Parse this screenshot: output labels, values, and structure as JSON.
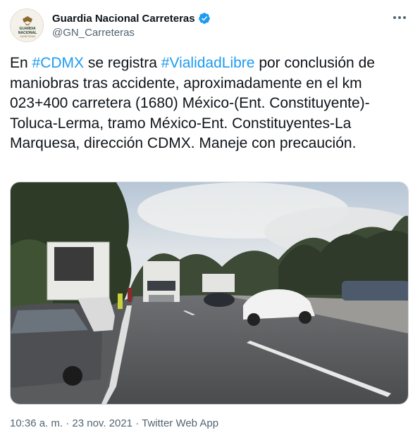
{
  "author": {
    "display_name": "Guardia Nacional Carreteras",
    "handle": "@GN_Carreteras",
    "avatar_text": [
      "GUARDIA",
      "NACIONAL",
      "CARRETERAS"
    ]
  },
  "tweet": {
    "text_parts": [
      "En ",
      "#CDMX",
      " se registra ",
      "#VialidadLibre",
      " por conclusión de maniobras tras accidente, aproximadamente en el km 023+400 carretera (1680) México-(Ent. Constituyente)-Toluca-Lerma, tramo México-Ent. Constituyentes-La Marquesa, dirección CDMX. Maneje con precaución."
    ],
    "time": "10:36 a. m.",
    "separator1": "·",
    "date": "23 nov. 2021",
    "separator2": "·",
    "source": "Twitter Web App"
  },
  "colors": {
    "link": "#1d9bf0",
    "text": "#0f1419",
    "muted": "#536471",
    "verified": "#1d9bf0"
  },
  "icons": {
    "verified": "verified-badge-icon",
    "more": "more-options-icon"
  }
}
